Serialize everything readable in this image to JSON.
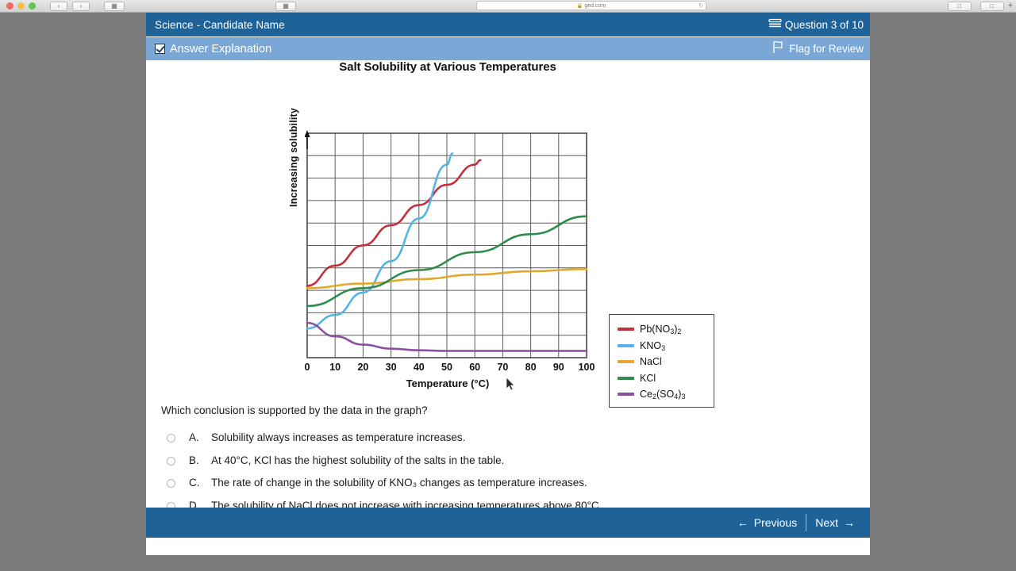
{
  "browser": {
    "url": "ged.com",
    "lock_icon": "lock-icon",
    "back_icon": "back-arrow-icon",
    "forward_icon": "forward-arrow-icon",
    "sidebar_icon": "sidebar-icon",
    "reader_icon": "reader-icon",
    "share_icon": "share-icon",
    "tabs_icon": "tabs-icon",
    "new_tab_label": "+"
  },
  "header": {
    "title": "Science - Candidate Name",
    "question_counter": "Question 3 of 10",
    "counter_icon": "calculator-icon"
  },
  "subheader": {
    "answer_explanation": "Answer Explanation",
    "checkbox_icon": "checked-checkbox-icon",
    "flag_label": "Flag for Review",
    "flag_icon": "flag-icon"
  },
  "chart_data": {
    "type": "line",
    "title": "Salt Solubility at Various Temperatures",
    "xlabel": "Temperature (°C)",
    "ylabel": "Increasing solubility",
    "xlim": [
      0,
      100
    ],
    "ylim": [
      0,
      10
    ],
    "grid": true,
    "x_ticks": [
      0,
      10,
      20,
      30,
      40,
      50,
      60,
      70,
      80,
      90,
      100
    ],
    "y_ticks": [],
    "legend_position": "right",
    "series": [
      {
        "name": "Pb(NO3)2",
        "name_parts": [
          "Pb(NO",
          "3",
          ")",
          "2"
        ],
        "color": "#c32f3d",
        "x": [
          0,
          10,
          20,
          30,
          40,
          50,
          60,
          62
        ],
        "values": [
          3.2,
          4.1,
          5.0,
          5.9,
          6.8,
          7.7,
          8.6,
          8.8
        ]
      },
      {
        "name": "KNO3",
        "name_parts": [
          "KNO",
          "3"
        ],
        "color": "#54b4e4",
        "x": [
          0,
          10,
          20,
          30,
          40,
          50,
          52
        ],
        "values": [
          1.3,
          1.9,
          2.9,
          4.3,
          6.2,
          8.6,
          9.1
        ]
      },
      {
        "name": "NaCl",
        "name_parts": [
          "NaCl"
        ],
        "color": "#e2a72e",
        "x": [
          0,
          20,
          40,
          60,
          80,
          100
        ],
        "values": [
          3.1,
          3.3,
          3.5,
          3.7,
          3.85,
          3.95
        ]
      },
      {
        "name": "KCl",
        "name_parts": [
          "KCl"
        ],
        "color": "#2f8b4c",
        "x": [
          0,
          20,
          40,
          60,
          80,
          100
        ],
        "values": [
          2.3,
          3.1,
          3.9,
          4.7,
          5.5,
          6.3
        ]
      },
      {
        "name": "Ce2(SO4)3",
        "name_parts": [
          "Ce",
          "2",
          "(SO",
          "4",
          ")",
          "3"
        ],
        "color": "#8c4fa0",
        "x": [
          0,
          10,
          20,
          30,
          40,
          50,
          60,
          70,
          80,
          90,
          100
        ],
        "values": [
          1.55,
          0.95,
          0.58,
          0.4,
          0.33,
          0.3,
          0.3,
          0.3,
          0.3,
          0.3,
          0.3
        ]
      }
    ]
  },
  "question": {
    "stem": "Which conclusion is supported by the data in the graph?",
    "options": [
      {
        "letter": "A.",
        "text": "Solubility always increases as temperature increases.",
        "selected": false
      },
      {
        "letter": "B.",
        "text": "At 40°C, KCl has the highest solubility of the salts in the table.",
        "selected": false
      },
      {
        "letter": "C.",
        "text": "The rate of change in the solubility of KNO₃ changes as temperature increases.",
        "selected": false
      },
      {
        "letter": "D.",
        "text": "The solubility of NaCl does not increase with increasing temperatures above 80°C.",
        "selected": false
      }
    ]
  },
  "footer": {
    "previous_label": "Previous",
    "next_label": "Next",
    "previous_icon": "arrow-left-icon",
    "next_icon": "arrow-right-icon"
  },
  "colors": {
    "header_blue": "#1f6298",
    "subheader_blue": "#7ba7d7",
    "desktop_gray": "#7a7a7a"
  }
}
